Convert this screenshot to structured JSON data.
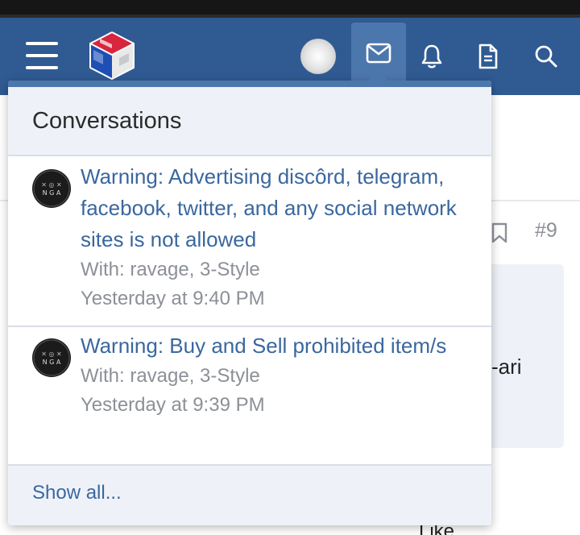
{
  "navbar": {
    "menu_icon": "hamburger-menu-icon",
    "logo_icon": "site-logo-cube",
    "avatar": "user-avatar",
    "icons": [
      "envelope-icon",
      "bell-icon",
      "document-icon",
      "search-icon"
    ],
    "accent_color": "#2f5a92",
    "active_color": "#4c77ad"
  },
  "background": {
    "post_number": "#9",
    "card_text_fragment": "-ari",
    "footer_fragment": "Like"
  },
  "dropdown": {
    "title": "Conversations",
    "conversations": [
      {
        "title": "Warning: Advertising discôrd, telegram, facebook, twitter, and any social network sites is not allowed",
        "with": "With: ravage, 3-Style",
        "time": "Yesterday at 9:40 PM"
      },
      {
        "title": "Warning: Buy and Sell prohibited item/s",
        "with": "With: ravage, 3-Style",
        "time": "Yesterday at 9:39 PM"
      }
    ],
    "show_all": "Show all..."
  }
}
